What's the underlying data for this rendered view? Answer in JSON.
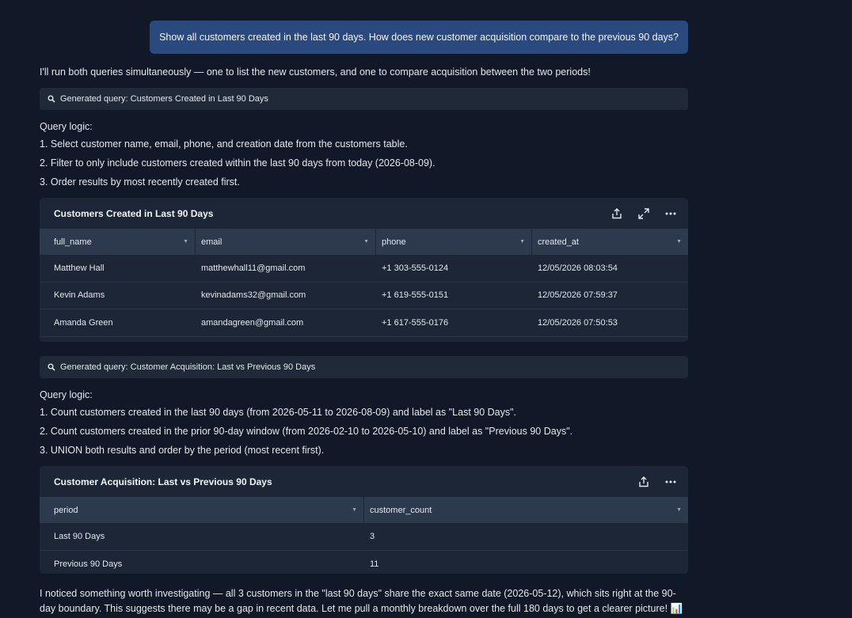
{
  "user_message": "Show all customers created in the last 90 days. How does new customer acquisition compare to the previous 90 days?",
  "intro": "I'll run both queries simultaneously — one to list the new customers, and one to compare acquisition between the two periods!",
  "query1": {
    "label": "Generated query: Customers Created in Last 90 Days",
    "logic_title": "Query logic:",
    "steps": [
      "1. Select customer name, email, phone, and creation date from the customers table.",
      "2. Filter to only include customers created within the last 90 days from today (2026-08-09).",
      "3. Order results by most recently created first."
    ],
    "table": {
      "title": "Customers Created in Last 90 Days",
      "columns": [
        "full_name",
        "email",
        "phone",
        "created_at"
      ],
      "rows": [
        [
          "Matthew Hall",
          "matthewhall11@gmail.com",
          "+1 303-555-0124",
          "12/05/2026 08:03:54"
        ],
        [
          "Kevin Adams",
          "kevinadams32@gmail.com",
          "+1 619-555-0151",
          "12/05/2026 07:59:37"
        ],
        [
          "Amanda Green",
          "amandagreen@gmail.com",
          "+1 617-555-0176",
          "12/05/2026 07:50:53"
        ]
      ]
    }
  },
  "query2": {
    "label": "Generated query: Customer Acquisition: Last vs Previous 90 Days",
    "logic_title": "Query logic:",
    "steps": [
      "1. Count customers created in the last 90 days (from 2026-05-11 to 2026-08-09) and label as \"Last 90 Days\".",
      "2. Count customers created in the prior 90-day window (from 2026-02-10 to 2026-05-10) and label as \"Previous 90 Days\".",
      "3. UNION both results and order by the period (most recent first)."
    ],
    "table": {
      "title": "Customer Acquisition: Last vs Previous 90 Days",
      "columns": [
        "period",
        "customer_count"
      ],
      "rows": [
        [
          "Last 90 Days",
          "3"
        ],
        [
          "Previous 90 Days",
          "11"
        ]
      ]
    }
  },
  "closing": "I noticed something worth investigating — all 3 customers in the \"last 90 days\" share the exact same date (2026-05-12), which sits right at the 90-day boundary. This suggests there may be a gap in recent data. Let me pull a monthly breakdown over the full 180 days to get a clearer picture! 📊"
}
